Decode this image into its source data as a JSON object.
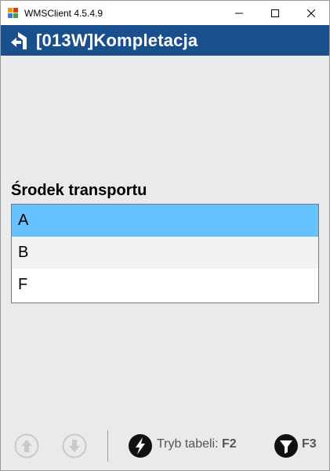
{
  "window": {
    "title": "WMSClient 4.5.4.9",
    "controls": [
      "minimize",
      "maximize",
      "close"
    ]
  },
  "header": {
    "title": "[013W]Kompletacja",
    "back_icon": "back-icon",
    "color": "#1a4f8e"
  },
  "field": {
    "label": "Środek transportu"
  },
  "list": {
    "items": [
      {
        "label": "A",
        "selected": true
      },
      {
        "label": "B",
        "selected": false
      },
      {
        "label": "F",
        "selected": false
      }
    ],
    "selected_color": "#63c2ff"
  },
  "footer": {
    "up_icon": "arrow-up-icon",
    "down_icon": "arrow-down-icon",
    "table_mode_icon": "lightning-icon",
    "table_mode_label": "Tryb tabeli:",
    "table_mode_key": "F2",
    "filter_icon": "filter-icon",
    "filter_key": "F3"
  }
}
